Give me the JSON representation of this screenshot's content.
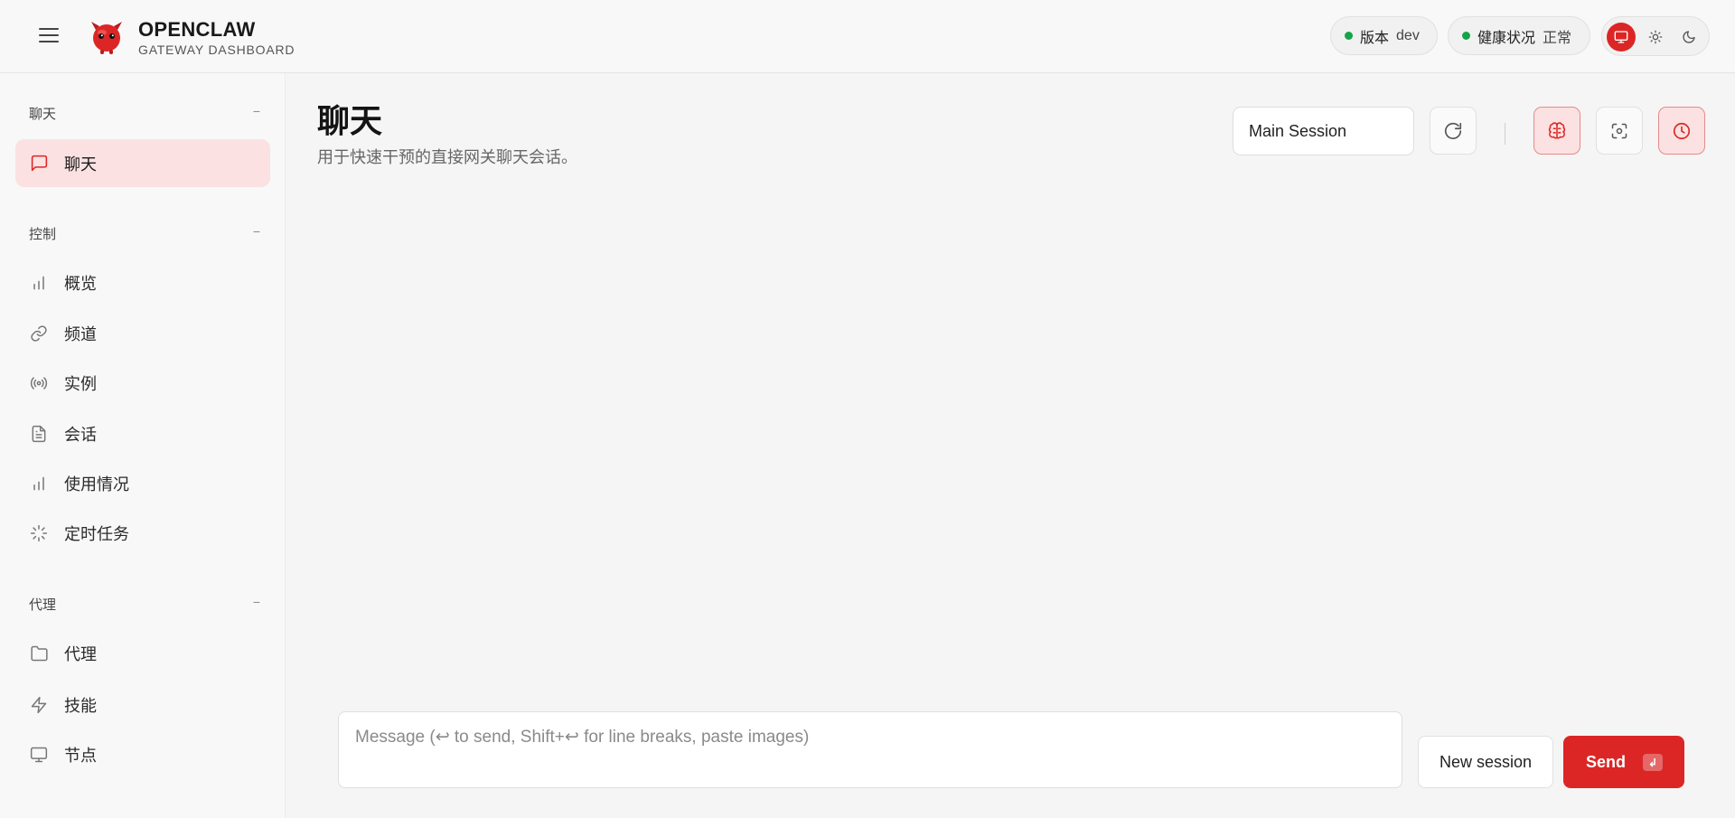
{
  "header": {
    "brand_title": "OPENCLAW",
    "brand_subtitle": "GATEWAY DASHBOARD",
    "version_label": "版本",
    "version_value": "dev",
    "health_label": "健康状况",
    "health_value": "正常",
    "status_color": "#16a34a",
    "accent_color": "#dc2626",
    "theme_options": [
      "monitor-icon",
      "sun-icon",
      "moon-icon"
    ],
    "theme_active": "monitor-icon"
  },
  "sidebar": {
    "groups": [
      {
        "label": "聊天",
        "collapse": "−",
        "items": [
          {
            "label": "聊天",
            "icon": "message-icon",
            "active": true
          }
        ]
      },
      {
        "label": "控制",
        "collapse": "−",
        "items": [
          {
            "label": "概览",
            "icon": "bar-chart-icon"
          },
          {
            "label": "频道",
            "icon": "link-icon"
          },
          {
            "label": "实例",
            "icon": "radio-icon"
          },
          {
            "label": "会话",
            "icon": "file-text-icon"
          },
          {
            "label": "使用情况",
            "icon": "bar-chart-icon"
          },
          {
            "label": "定时任务",
            "icon": "loader-icon"
          }
        ]
      },
      {
        "label": "代理",
        "collapse": "−",
        "items": [
          {
            "label": "代理",
            "icon": "folder-icon"
          },
          {
            "label": "技能",
            "icon": "zap-icon"
          },
          {
            "label": "节点",
            "icon": "monitor-icon"
          }
        ]
      }
    ]
  },
  "main": {
    "title": "聊天",
    "subtitle": "用于快速干预的直接网关聊天会话。",
    "session_select": "Main Session",
    "toolbar": [
      "refresh-icon",
      "brain-icon",
      "focus-icon",
      "clock-icon"
    ]
  },
  "composer": {
    "placeholder": "Message (↩ to send, Shift+↩ for line breaks, paste images)",
    "value": "",
    "new_session_label": "New session",
    "send_label": "Send",
    "send_kbd": "↲"
  }
}
